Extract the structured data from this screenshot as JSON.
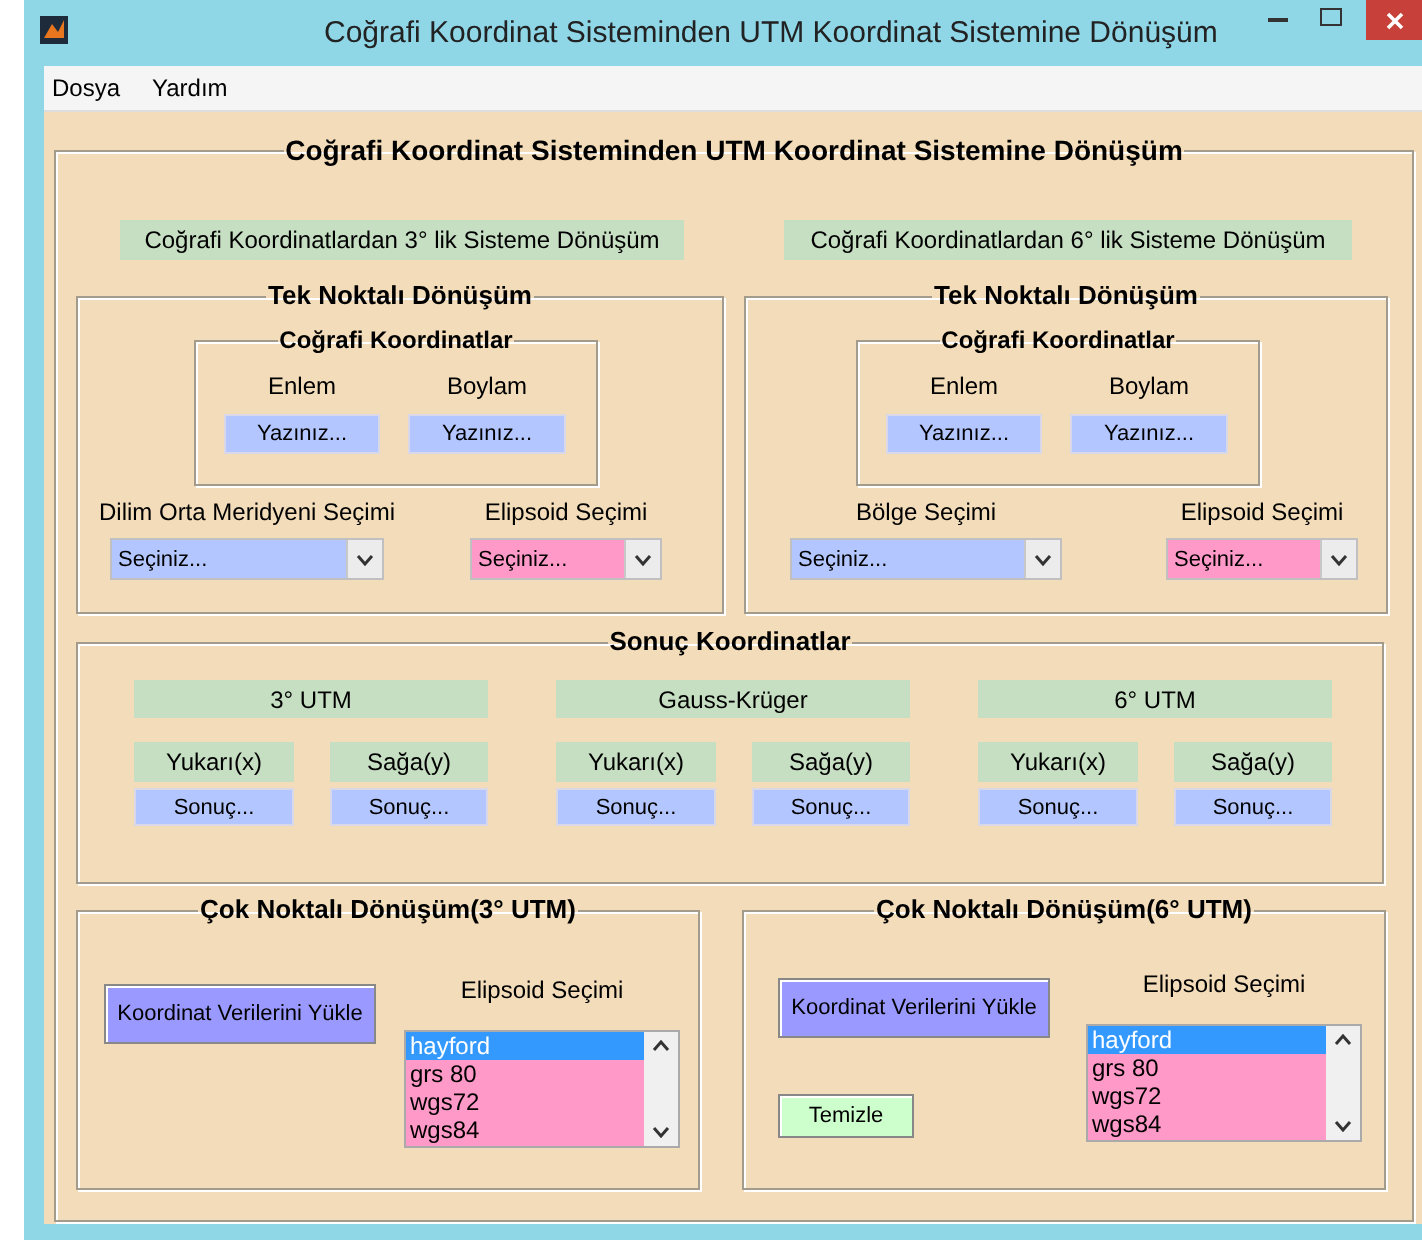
{
  "window": {
    "title": "Coğrafi Koordinat Sisteminden UTM Koordinat Sistemine Dönüşüm"
  },
  "menu": [
    {
      "label": "Dosya"
    },
    {
      "label": "Yardım"
    }
  ],
  "main_panel": {
    "title": "Coğrafi Koordinat Sisteminden UTM Koordinat Sistemine Dönüşüm",
    "system_labels": [
      "Coğrafi Koordinatlardan 3° lik Sisteme Dönüşüm",
      "Coğrafi Koordinatlardan 6° lik Sisteme Dönüşüm"
    ],
    "single_point": [
      {
        "title": "Tek Noktalı Dönüşüm",
        "coords_title": "Coğrafi Koordinatlar",
        "lat_label": "Enlem",
        "lat_value": "Yazınız...",
        "lon_label": "Boylam",
        "lon_value": "Yazınız...",
        "zone_label": "Dilim Orta Meridyeni Seçimi",
        "zone_value": "Seçiniz...",
        "ellipsoid_label": "Elipsoid Seçimi",
        "ellipsoid_value": "Seçiniz..."
      },
      {
        "title": "Tek Noktalı Dönüşüm",
        "coords_title": "Coğrafi Koordinatlar",
        "lat_label": "Enlem",
        "lat_value": "Yazınız...",
        "lon_label": "Boylam",
        "lon_value": "Yazınız...",
        "zone_label": "Bölge Seçimi",
        "zone_value": "Seçiniz...",
        "ellipsoid_label": "Elipsoid Seçimi",
        "ellipsoid_value": "Seçiniz..."
      }
    ],
    "results": {
      "title": "Sonuç Koordinatlar",
      "groups": [
        {
          "title": "3° UTM",
          "x_label": "Yukarı(x)",
          "x_value": "Sonuç...",
          "y_label": "Sağa(y)",
          "y_value": "Sonuç..."
        },
        {
          "title": "Gauss-Krüger",
          "x_label": "Yukarı(x)",
          "x_value": "Sonuç...",
          "y_label": "Sağa(y)",
          "y_value": "Sonuç..."
        },
        {
          "title": "6° UTM",
          "x_label": "Yukarı(x)",
          "x_value": "Sonuç...",
          "y_label": "Sağa(y)",
          "y_value": "Sonuç..."
        }
      ]
    },
    "multi_point": [
      {
        "title": "Çok Noktalı Dönüşüm(3° UTM)",
        "buttons": [
          {
            "kind": "load",
            "label": "Koordinat Verilerini Yükle"
          }
        ],
        "ellipsoid_label": "Elipsoid Seçimi",
        "ellipsoids": [
          {
            "label": "hayford",
            "selected": true
          },
          {
            "label": "grs 80",
            "selected": false
          },
          {
            "label": "wgs72",
            "selected": false
          },
          {
            "label": "wgs84",
            "selected": false
          }
        ]
      },
      {
        "title": "Çok Noktalı Dönüşüm(6° UTM)",
        "buttons": [
          {
            "kind": "load",
            "label": "Koordinat Verilerini Yükle"
          },
          {
            "kind": "clear",
            "label": "Temizle"
          }
        ],
        "ellipsoid_label": "Elipsoid Seçimi",
        "ellipsoids": [
          {
            "label": "hayford",
            "selected": true
          },
          {
            "label": "grs 80",
            "selected": false
          },
          {
            "label": "wgs72",
            "selected": false
          },
          {
            "label": "wgs84",
            "selected": false
          }
        ]
      }
    ]
  }
}
